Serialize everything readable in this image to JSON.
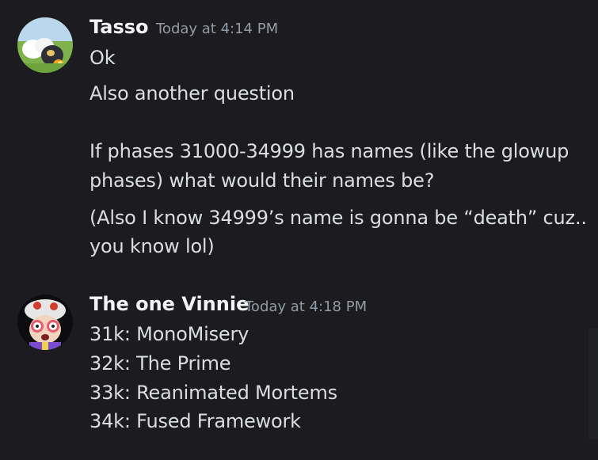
{
  "messages": [
    {
      "author": "Tasso",
      "timestamp": "Today at 4:14 PM",
      "lines": [
        "Ok",
        "Also another question",
        "If phases 31000-34999 has names (like the glowup",
        "phases) what would their names be?",
        "(Also I know 34999’s name is gonna be “death” cuz..",
        "you know lol)"
      ]
    },
    {
      "author": "The one Vinnie",
      "timestamp": "Today at 4:18 PM",
      "lines": [
        "31k: MonoMisery",
        "32k: The Prime",
        "33k: Reanimated Mortems",
        "34k: Fused Framework"
      ]
    }
  ]
}
